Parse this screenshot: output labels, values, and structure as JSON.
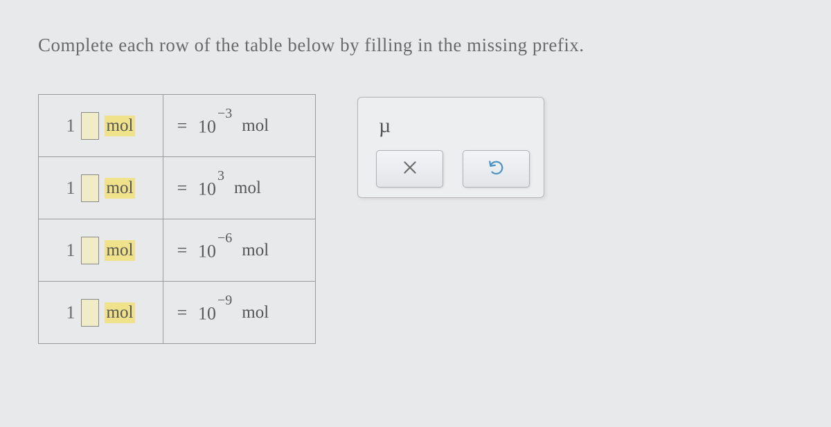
{
  "question": "Complete each row of the table below by filling in the missing prefix.",
  "rows": [
    {
      "one": "1",
      "unit": "mol",
      "eq": "=",
      "base": "10",
      "exp": "−3",
      "unit2": "mol"
    },
    {
      "one": "1",
      "unit": "mol",
      "eq": "=",
      "base": "10",
      "exp": "3",
      "unit2": "mol"
    },
    {
      "one": "1",
      "unit": "mol",
      "eq": "=",
      "base": "10",
      "exp": "−6",
      "unit2": "mol"
    },
    {
      "one": "1",
      "unit": "mol",
      "eq": "=",
      "base": "10",
      "exp": "−9",
      "unit2": "mol"
    }
  ],
  "panel": {
    "mu": "µ"
  }
}
